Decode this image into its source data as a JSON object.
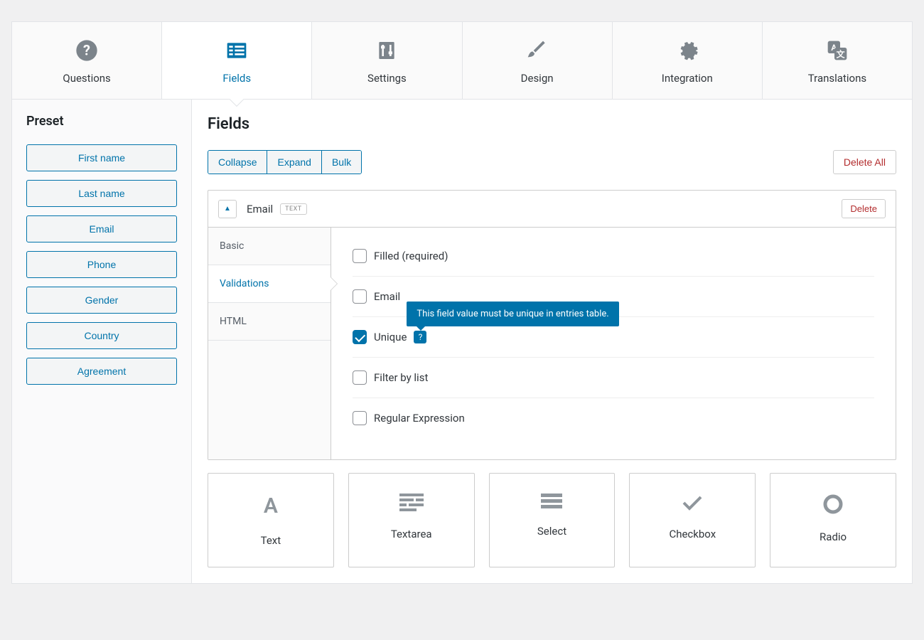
{
  "tabs": [
    {
      "id": "questions",
      "label": "Questions",
      "icon": "question"
    },
    {
      "id": "fields",
      "label": "Fields",
      "icon": "grid",
      "active": true
    },
    {
      "id": "settings",
      "label": "Settings",
      "icon": "sliders"
    },
    {
      "id": "design",
      "label": "Design",
      "icon": "brush"
    },
    {
      "id": "integration",
      "label": "Integration",
      "icon": "gear"
    },
    {
      "id": "translations",
      "label": "Translations",
      "icon": "translate"
    }
  ],
  "sidebar": {
    "title": "Preset",
    "presets": [
      "First name",
      "Last name",
      "Email",
      "Phone",
      "Gender",
      "Country",
      "Agreement"
    ]
  },
  "main": {
    "title": "Fields",
    "buttons": {
      "collapse": "Collapse",
      "expand": "Expand",
      "bulk": "Bulk",
      "delete_all": "Delete All"
    },
    "field": {
      "name": "Email",
      "type_badge": "TEXT",
      "delete": "Delete",
      "side_tabs": {
        "basic": "Basic",
        "validations": "Validations",
        "html": "HTML"
      },
      "validations": [
        {
          "key": "filled",
          "label": "Filled (required)",
          "checked": false
        },
        {
          "key": "email",
          "label": "Email",
          "checked": false
        },
        {
          "key": "unique",
          "label": "Unique",
          "checked": true,
          "help": "This field value must be unique in entries table."
        },
        {
          "key": "filter",
          "label": "Filter by list",
          "checked": false
        },
        {
          "key": "regex",
          "label": "Regular Expression",
          "checked": false
        }
      ]
    },
    "field_types": [
      {
        "id": "text",
        "label": "Text",
        "icon": "A"
      },
      {
        "id": "textarea",
        "label": "Textarea",
        "icon": "lines"
      },
      {
        "id": "select",
        "label": "Select",
        "icon": "menu"
      },
      {
        "id": "checkbox",
        "label": "Checkbox",
        "icon": "check"
      },
      {
        "id": "radio",
        "label": "Radio",
        "icon": "circle"
      }
    ]
  }
}
